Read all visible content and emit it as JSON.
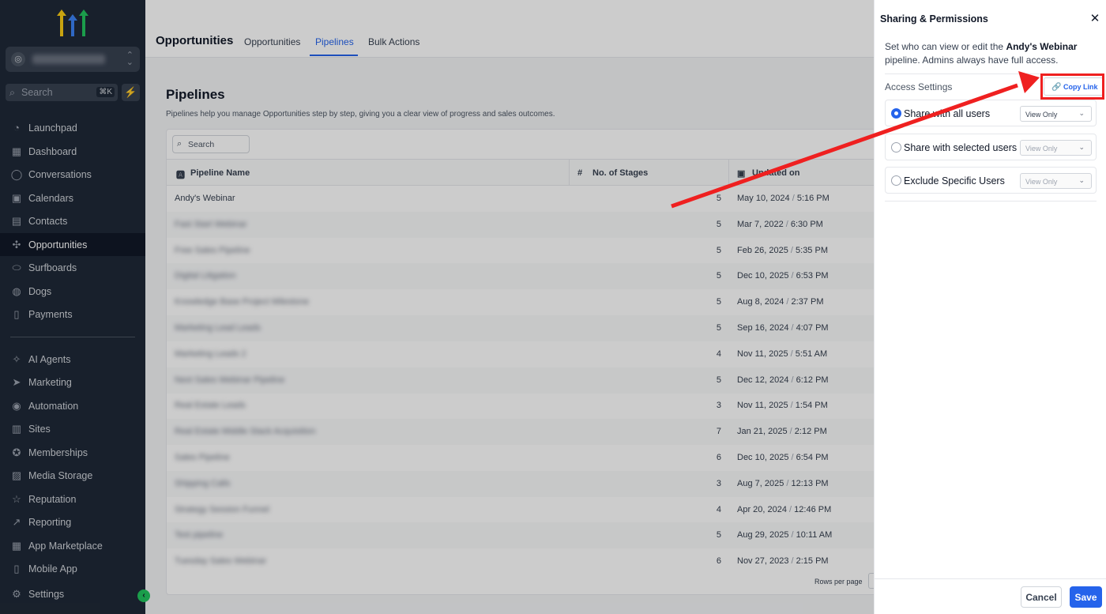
{
  "sidebar": {
    "search_label": "Search",
    "search_shortcut": "⌘K",
    "nav": [
      {
        "label": "Launchpad",
        "icon": "launchpad-icon"
      },
      {
        "label": "Dashboard",
        "icon": "dashboard-icon"
      },
      {
        "label": "Conversations",
        "icon": "chat-bubble-icon"
      },
      {
        "label": "Calendars",
        "icon": "calendar-icon"
      },
      {
        "label": "Contacts",
        "icon": "contacts-icon"
      },
      {
        "label": "Opportunities",
        "icon": "opportunities-icon",
        "active": true
      },
      {
        "label": "Surfboards",
        "icon": "surfboard-icon"
      },
      {
        "label": "Dogs",
        "icon": "dog-icon"
      },
      {
        "label": "Payments",
        "icon": "payments-icon"
      },
      {
        "label": "AI Agents",
        "icon": "sparkle-icon"
      },
      {
        "label": "Marketing",
        "icon": "send-icon"
      },
      {
        "label": "Automation",
        "icon": "automation-icon"
      },
      {
        "label": "Sites",
        "icon": "sites-icon"
      },
      {
        "label": "Memberships",
        "icon": "memberships-icon"
      },
      {
        "label": "Media Storage",
        "icon": "image-icon"
      },
      {
        "label": "Reputation",
        "icon": "star-icon"
      },
      {
        "label": "Reporting",
        "icon": "trend-icon"
      },
      {
        "label": "App Marketplace",
        "icon": "grid-icon"
      },
      {
        "label": "Mobile App",
        "icon": "mobile-icon"
      },
      {
        "label": "Settings",
        "icon": "gear-icon"
      }
    ]
  },
  "header": {
    "title": "Opportunities",
    "tabs": [
      "Opportunities",
      "Pipelines",
      "Bulk Actions"
    ],
    "active_tab": "Pipelines"
  },
  "page": {
    "heading": "Pipelines",
    "subtitle": "Pipelines help you manage Opportunities step by step, giving you a clear view of progress and sales outcomes.",
    "table_search_placeholder": "Search",
    "columns": [
      "Pipeline Name",
      "No. of Stages",
      "Updated on"
    ],
    "rows": [
      {
        "name": "Andy's Webinar",
        "stages": "5",
        "date": "May 10, 2024",
        "time": "5:16 PM"
      },
      {
        "name": "Fast Start Webinar",
        "stages": "5",
        "date": "Mar 7, 2022",
        "time": "6:30 PM"
      },
      {
        "name": "Free Sales Pipeline",
        "stages": "5",
        "date": "Feb 26, 2025",
        "time": "5:35 PM"
      },
      {
        "name": "Digital Litigation",
        "stages": "5",
        "date": "Dec 10, 2025",
        "time": "6:53 PM"
      },
      {
        "name": "Knowledge Base Project Milestone",
        "stages": "5",
        "date": "Aug 8, 2024",
        "time": "2:37 PM"
      },
      {
        "name": "Marketing Lead Leads",
        "stages": "5",
        "date": "Sep 16, 2024",
        "time": "4:07 PM"
      },
      {
        "name": "Marketing Leads 2",
        "stages": "4",
        "date": "Nov 11, 2025",
        "time": "5:51 AM"
      },
      {
        "name": "Next Sales Webinar Pipeline",
        "stages": "5",
        "date": "Dec 12, 2024",
        "time": "6:12 PM"
      },
      {
        "name": "Real Estate Leads",
        "stages": "3",
        "date": "Nov 11, 2025",
        "time": "1:54 PM"
      },
      {
        "name": "Real Estate Middle Stack Acquisition",
        "stages": "7",
        "date": "Jan 21, 2025",
        "time": "2:12 PM"
      },
      {
        "name": "Sales Pipeline",
        "stages": "6",
        "date": "Dec 10, 2025",
        "time": "6:54 PM"
      },
      {
        "name": "Shipping Calls",
        "stages": "3",
        "date": "Aug 7, 2025",
        "time": "12:13 PM"
      },
      {
        "name": "Strategy Session Funnel",
        "stages": "4",
        "date": "Apr 20, 2024",
        "time": "12:46 PM"
      },
      {
        "name": "Test pipeline",
        "stages": "5",
        "date": "Aug 29, 2025",
        "time": "10:11 AM"
      },
      {
        "name": "Tuesday Sales Webinar",
        "stages": "6",
        "date": "Nov 27, 2023",
        "time": "2:15 PM"
      }
    ],
    "rows_per_page_label": "Rows per page"
  },
  "panel": {
    "title": "Sharing & Permissions",
    "desc_prefix": "Set who can view or edit the",
    "pipeline_name": "Andy's Webinar",
    "desc_suffix": "pipeline. Admins always have full access.",
    "access_label": "Access Settings",
    "copy_link_label": "Copy Link",
    "options": [
      {
        "label": "Share with all users",
        "selected": true,
        "permission": "View Only",
        "enabled": true
      },
      {
        "label": "Share with selected users",
        "selected": false,
        "permission": "View Only",
        "enabled": false
      },
      {
        "label": "Exclude Specific Users",
        "selected": false,
        "permission": "View Only",
        "enabled": false
      }
    ],
    "cancel_label": "Cancel",
    "save_label": "Save"
  },
  "colors": {
    "accent": "#2563eb",
    "sidebar_bg": "#1f2937",
    "highlight": "#ef2020",
    "bolt": "#22c55e"
  }
}
